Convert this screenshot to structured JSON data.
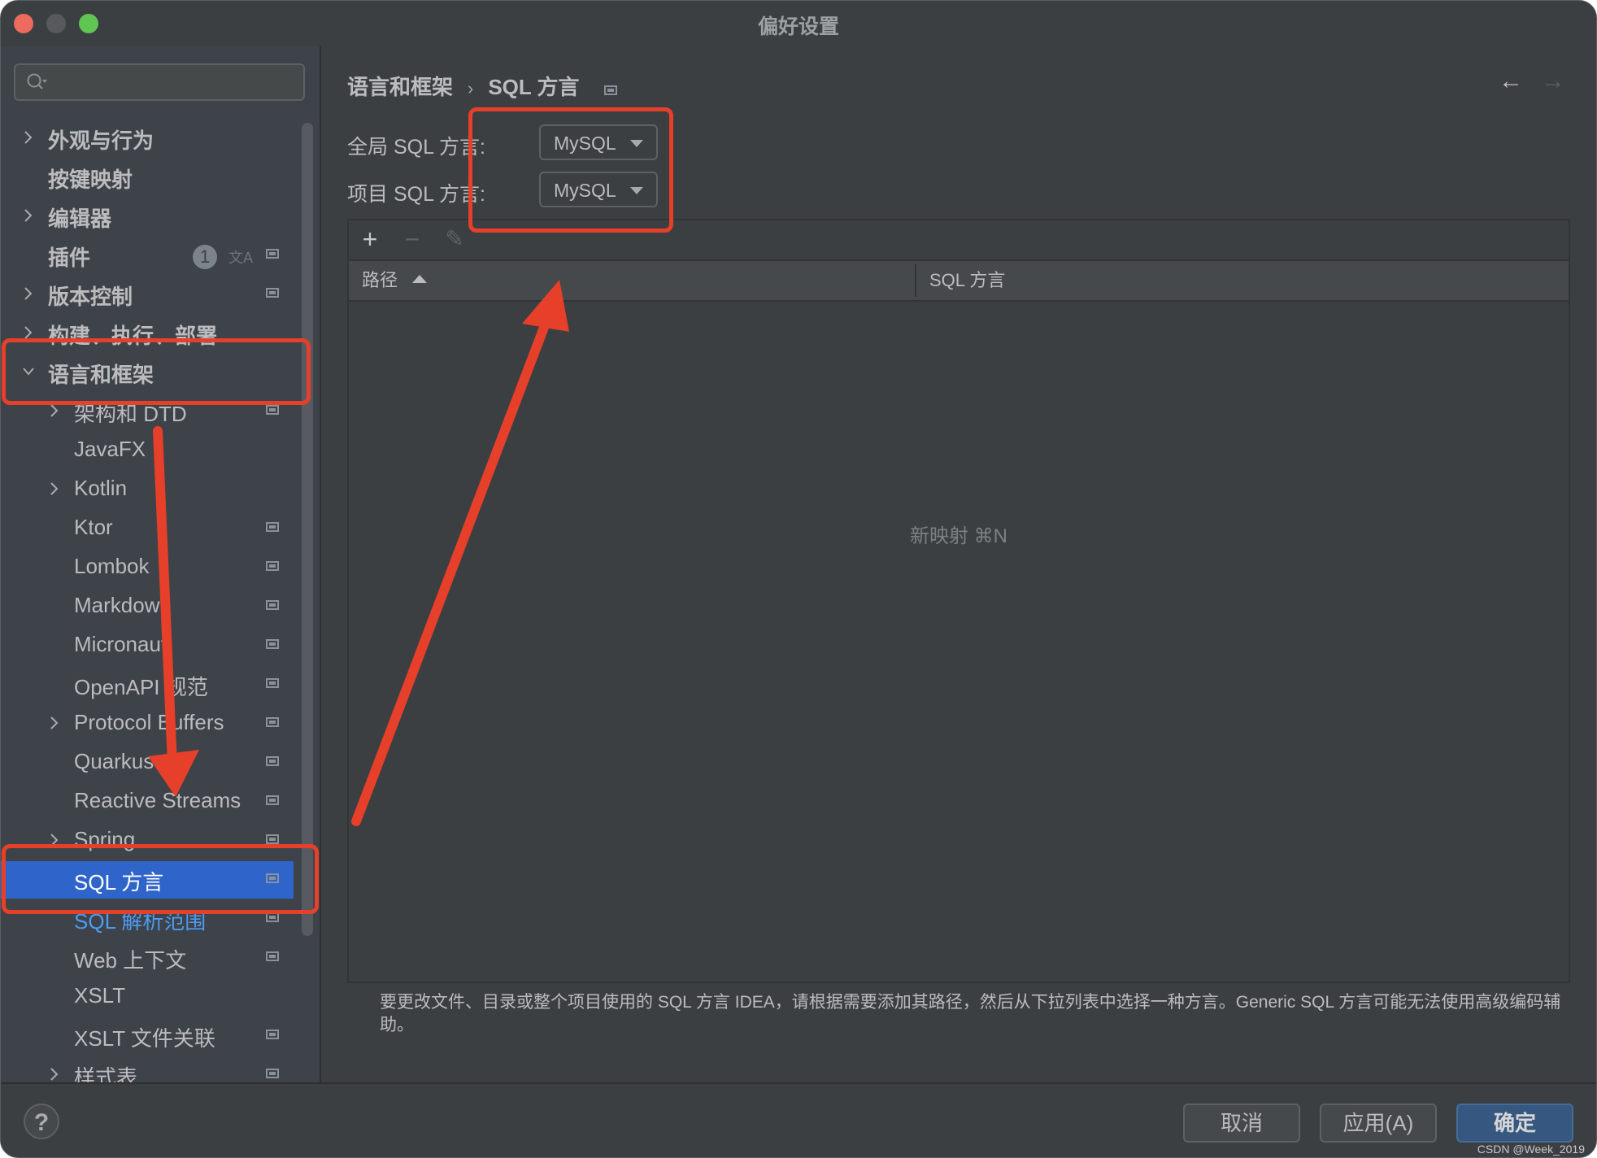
{
  "window": {
    "title": "偏好设置"
  },
  "search": {
    "placeholder": "",
    "icon": "search-icon"
  },
  "sidebar": {
    "items": [
      {
        "label": "外观与行为",
        "level": 0,
        "expandable": true,
        "expanded": false
      },
      {
        "label": "按键映射",
        "level": 0,
        "expandable": false
      },
      {
        "label": "编辑器",
        "level": 0,
        "expandable": true,
        "expanded": false
      },
      {
        "label": "插件",
        "level": 0,
        "expandable": false,
        "badge": "1",
        "translate_icon": true,
        "project_icon": true
      },
      {
        "label": "版本控制",
        "level": 0,
        "expandable": true,
        "expanded": false,
        "project_icon": true
      },
      {
        "label": "构建、执行、部署",
        "level": 0,
        "expandable": true,
        "expanded": false
      },
      {
        "label": "语言和框架",
        "level": 0,
        "expandable": true,
        "expanded": true
      },
      {
        "label": "架构和 DTD",
        "level": 1,
        "expandable": true,
        "expanded": false,
        "project_icon": true
      },
      {
        "label": "JavaFX",
        "level": 1,
        "expandable": false
      },
      {
        "label": "Kotlin",
        "level": 1,
        "expandable": true,
        "expanded": false
      },
      {
        "label": "Ktor",
        "level": 1,
        "expandable": false,
        "project_icon": true
      },
      {
        "label": "Lombok",
        "level": 1,
        "expandable": false,
        "project_icon": true
      },
      {
        "label": "Markdown",
        "level": 1,
        "expandable": false,
        "project_icon": true
      },
      {
        "label": "Micronaut",
        "level": 1,
        "expandable": false,
        "project_icon": true
      },
      {
        "label": "OpenAPI 规范",
        "level": 1,
        "expandable": false,
        "project_icon": true
      },
      {
        "label": "Protocol Buffers",
        "level": 1,
        "expandable": true,
        "expanded": false,
        "project_icon": true
      },
      {
        "label": "Quarkus",
        "level": 1,
        "expandable": false,
        "project_icon": true
      },
      {
        "label": "Reactive Streams",
        "level": 1,
        "expandable": false,
        "project_icon": true
      },
      {
        "label": "Spring",
        "level": 1,
        "expandable": true,
        "expanded": false,
        "project_icon": true
      },
      {
        "label": "SQL 方言",
        "level": 1,
        "expandable": false,
        "selected": true,
        "project_icon": true
      },
      {
        "label": "SQL 解析范围",
        "level": 1,
        "expandable": false,
        "link": true,
        "project_icon": true
      },
      {
        "label": "Web 上下文",
        "level": 1,
        "expandable": false,
        "project_icon": true
      },
      {
        "label": "XSLT",
        "level": 1,
        "expandable": false
      },
      {
        "label": "XSLT 文件关联",
        "level": 1,
        "expandable": false,
        "project_icon": true
      },
      {
        "label": "样式表",
        "level": 1,
        "expandable": true,
        "expanded": false,
        "project_icon": true
      }
    ]
  },
  "main": {
    "breadcrumb": {
      "parent": "语言和框架",
      "separator": "›",
      "current": "SQL 方言"
    },
    "nav": {
      "back": "←",
      "forward": "→"
    },
    "global_dialect": {
      "label": "全局 SQL 方言:",
      "value": "MySQL"
    },
    "project_dialect": {
      "label": "项目 SQL 方言:",
      "value": "MySQL"
    },
    "table": {
      "toolbar": {
        "add": "+",
        "remove": "−",
        "edit": "✎"
      },
      "columns": [
        {
          "label": "路径",
          "sorted": "ascending"
        },
        {
          "label": "SQL 方言"
        }
      ],
      "rows": [],
      "empty_text": "新映射 ⌘N"
    },
    "help_text": "要更改文件、目录或整个项目使用的 SQL 方言 IDEA，请根据需要添加其路径，然后从下拉列表中选择一种方言。Generic SQL 方言可能无法使用高级编码辅助。"
  },
  "footer": {
    "help": "?",
    "cancel": "取消",
    "apply": "应用(A)",
    "ok": "确定"
  },
  "watermark": "CSDN @Week_2019",
  "colors": {
    "selection": "#2f65ca",
    "link": "#4b9cf2",
    "annotation": "#e63f2a",
    "ok_button": "#365880"
  }
}
